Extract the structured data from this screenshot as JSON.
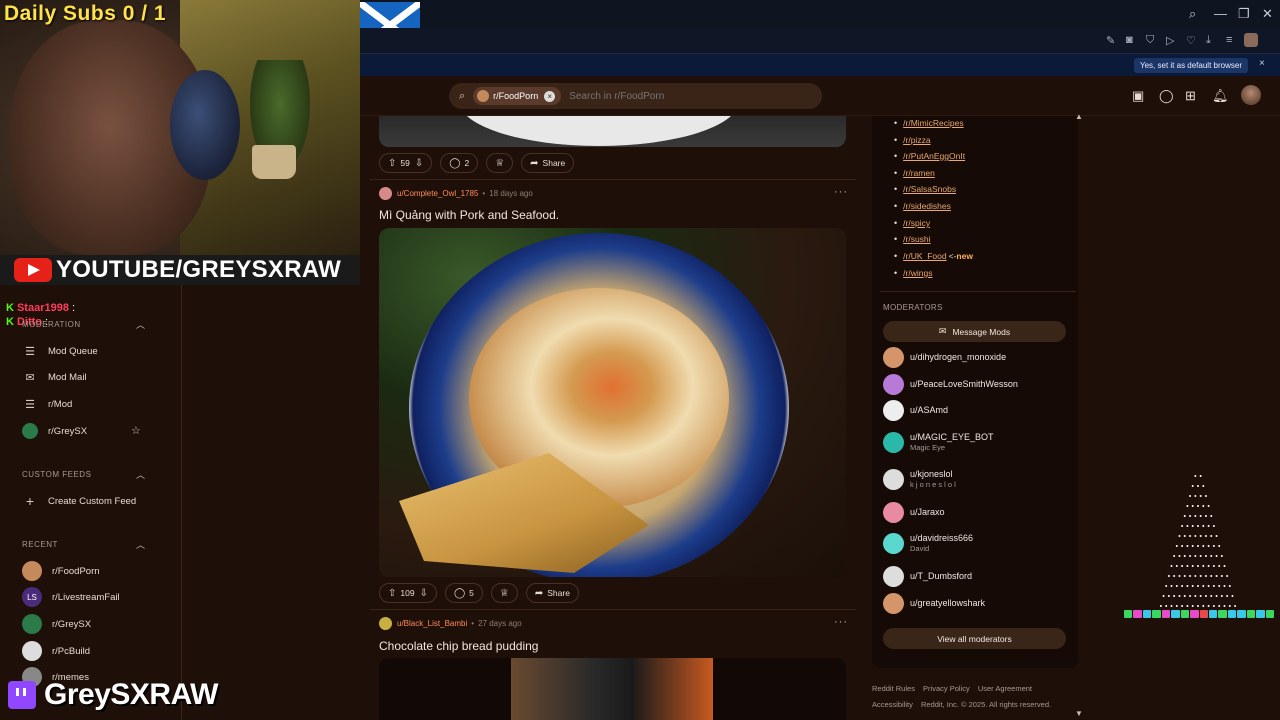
{
  "overlay": {
    "daily_subs": "Daily Subs  0 / 1",
    "youtube": "YOUTUBE/GREYSXRAW",
    "twitch": "GreySXRAW",
    "chat": [
      {
        "user": "Staar1998",
        "text": ":"
      },
      {
        "user": "Ditto",
        "text": ":"
      }
    ]
  },
  "browser": {
    "default_prompt": "Yes, set it as default browser",
    "close": "×"
  },
  "header": {
    "community_chip": "r/FoodPorn",
    "search_placeholder": "Search in r/FoodPorn"
  },
  "sidebar": {
    "moderation_label": "MODERATION",
    "mod_items": [
      {
        "label": "Mod Queue",
        "icon": "queue-icon"
      },
      {
        "label": "Mod Mail",
        "icon": "mail-icon"
      },
      {
        "label": "r/Mod",
        "icon": "mod-icon"
      },
      {
        "label": "r/GreySX",
        "icon": "community-icon"
      }
    ],
    "custom_feeds_label": "CUSTOM FEEDS",
    "create_feed": "Create Custom Feed",
    "recent_label": "RECENT",
    "recent_items": [
      {
        "label": "r/FoodPorn",
        "color": "#c48a5c"
      },
      {
        "label": "r/LivestreamFail",
        "color": "#4a2a7a"
      },
      {
        "label": "r/GreySX",
        "color": "#2a7a4a"
      },
      {
        "label": "r/PcBuild",
        "color": "#dddddd"
      },
      {
        "label": "r/memes",
        "color": "#888888"
      }
    ]
  },
  "feed": {
    "post0": {
      "upvotes": "59",
      "comments": "2",
      "share": "Share"
    },
    "post1": {
      "user": "u/Complete_Owl_1785",
      "time": "18 days ago",
      "title": "Mì Quảng with Pork and Seafood.",
      "upvotes": "109",
      "comments": "5",
      "share": "Share"
    },
    "post2": {
      "user": "u/Black_List_Bambi",
      "time": "27 days ago",
      "title": "Chocolate chip bread pudding"
    }
  },
  "right": {
    "related": [
      {
        "label": "/r/MimicRecipes",
        "suffix": ""
      },
      {
        "label": "/r/pizza",
        "suffix": ""
      },
      {
        "label": "/r/PutAnEggOnIt",
        "suffix": ""
      },
      {
        "label": "/r/ramen",
        "suffix": ""
      },
      {
        "label": "/r/SalsaSnobs",
        "suffix": ""
      },
      {
        "label": "/r/sidedishes",
        "suffix": ""
      },
      {
        "label": "/r/spicy",
        "suffix": ""
      },
      {
        "label": "/r/sushi",
        "suffix": ""
      },
      {
        "label": "/r/UK_Food",
        "suffix": " <-",
        "new": "new"
      },
      {
        "label": "/r/wings",
        "suffix": ""
      }
    ],
    "moderators_title": "MODERATORS",
    "message_mods": "Message Mods",
    "moderators": [
      {
        "name": "u/dihydrogen_monoxide",
        "flair": "",
        "color": "#d4956a"
      },
      {
        "name": "u/PeaceLoveSmithWesson",
        "flair": "",
        "color": "#b87ad8"
      },
      {
        "name": "u/ASAmd",
        "flair": "",
        "color": "#eeeeee"
      },
      {
        "name": "u/MAGIC_EYE_BOT",
        "flair": "Magic Eye",
        "color": "#2ab8a8"
      },
      {
        "name": "u/kjoneslol",
        "flair": "k j o n e s l o l",
        "color": "#dddddd"
      },
      {
        "name": "u/Jaraxo",
        "flair": "",
        "color": "#e88aa0"
      },
      {
        "name": "u/davidreiss666",
        "flair": "David",
        "color": "#5ad8d0"
      },
      {
        "name": "u/T_Dumbsford",
        "flair": "",
        "color": "#dddddd"
      },
      {
        "name": "u/greatyellowshark",
        "flair": "",
        "color": "#d4956a"
      }
    ],
    "view_all": "View all moderators",
    "footer": [
      "Reddit Rules",
      "Privacy Policy",
      "User Agreement",
      "Accessibility",
      "Reddit, Inc. © 2025. All rights reserved."
    ]
  }
}
